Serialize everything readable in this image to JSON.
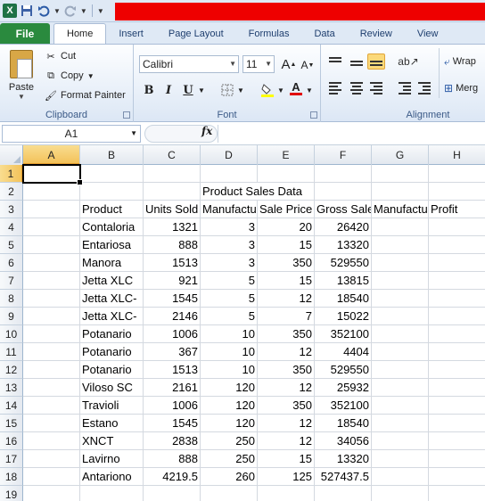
{
  "app": {
    "logo": "X",
    "qat_icons": [
      "excel-logo",
      "save-icon",
      "undo-icon",
      "redo-icon",
      "customize-qat-icon"
    ]
  },
  "ribbon": {
    "file_tab": "File",
    "tabs": [
      "Home",
      "Insert",
      "Page Layout",
      "Formulas",
      "Data",
      "Review",
      "View"
    ],
    "active_tab": "Home",
    "clipboard": {
      "paste": "Paste",
      "cut": "Cut",
      "copy": "Copy",
      "format_painter": "Format Painter",
      "label": "Clipboard"
    },
    "font": {
      "name": "Calibri",
      "size": "11",
      "bold": "B",
      "italic": "I",
      "underline": "U",
      "grow": "A",
      "shrink": "A",
      "label": "Font"
    },
    "alignment": {
      "wrap": "Wrap",
      "merge": "Merg",
      "label": "Alignment"
    }
  },
  "formula_bar": {
    "name_box": "A1",
    "fx": "fx",
    "content": ""
  },
  "sheet": {
    "columns": [
      "A",
      "B",
      "C",
      "D",
      "E",
      "F",
      "G",
      "H"
    ],
    "selected_column": "A",
    "selected_row": "1",
    "rows": [
      {
        "n": "1",
        "cells": [
          "",
          "",
          "",
          "",
          "",
          "",
          "",
          ""
        ]
      },
      {
        "n": "2",
        "cells": [
          "",
          "",
          "",
          "Product Sales Data",
          "",
          "",
          "",
          ""
        ]
      },
      {
        "n": "3",
        "cells": [
          "",
          "Product",
          "Units Sold",
          "Manufacturing",
          "Sale Price",
          "Gross Sales",
          "Manufacturing",
          "Profit"
        ]
      },
      {
        "n": "4",
        "cells": [
          "",
          "Contaloria",
          "1321",
          "3",
          "20",
          "26420",
          "",
          ""
        ]
      },
      {
        "n": "5",
        "cells": [
          "",
          "Entariosa",
          "888",
          "3",
          "15",
          "13320",
          "",
          ""
        ]
      },
      {
        "n": "6",
        "cells": [
          "",
          "Manora",
          "1513",
          "3",
          "350",
          "529550",
          "",
          ""
        ]
      },
      {
        "n": "7",
        "cells": [
          "",
          "Jetta XLC",
          "921",
          "5",
          "15",
          "13815",
          "",
          ""
        ]
      },
      {
        "n": "8",
        "cells": [
          "",
          "Jetta XLC-",
          "1545",
          "5",
          "12",
          "18540",
          "",
          ""
        ]
      },
      {
        "n": "9",
        "cells": [
          "",
          "Jetta XLC-",
          "2146",
          "5",
          "7",
          "15022",
          "",
          ""
        ]
      },
      {
        "n": "10",
        "cells": [
          "",
          "Potanario",
          "1006",
          "10",
          "350",
          "352100",
          "",
          ""
        ]
      },
      {
        "n": "11",
        "cells": [
          "",
          "Potanario",
          "367",
          "10",
          "12",
          "4404",
          "",
          ""
        ]
      },
      {
        "n": "12",
        "cells": [
          "",
          "Potanario",
          "1513",
          "10",
          "350",
          "529550",
          "",
          ""
        ]
      },
      {
        "n": "13",
        "cells": [
          "",
          "Viloso SC",
          "2161",
          "120",
          "12",
          "25932",
          "",
          ""
        ]
      },
      {
        "n": "14",
        "cells": [
          "",
          "Travioli",
          "1006",
          "120",
          "350",
          "352100",
          "",
          ""
        ]
      },
      {
        "n": "15",
        "cells": [
          "",
          "Estano",
          "1545",
          "120",
          "12",
          "18540",
          "",
          ""
        ]
      },
      {
        "n": "16",
        "cells": [
          "",
          "XNCT",
          "2838",
          "250",
          "12",
          "34056",
          "",
          ""
        ]
      },
      {
        "n": "17",
        "cells": [
          "",
          "Lavirno",
          "888",
          "250",
          "15",
          "13320",
          "",
          ""
        ]
      },
      {
        "n": "18",
        "cells": [
          "",
          "Antariono",
          "4219.5",
          "260",
          "125",
          "527437.5",
          "",
          ""
        ]
      },
      {
        "n": "19",
        "cells": [
          "",
          "",
          "",
          "",
          "",
          "",
          "",
          ""
        ]
      }
    ]
  },
  "colors": {
    "title_redaction": "#ee0000",
    "file_tab": "#2a8a3e",
    "selection_header": "#f3c25a"
  }
}
